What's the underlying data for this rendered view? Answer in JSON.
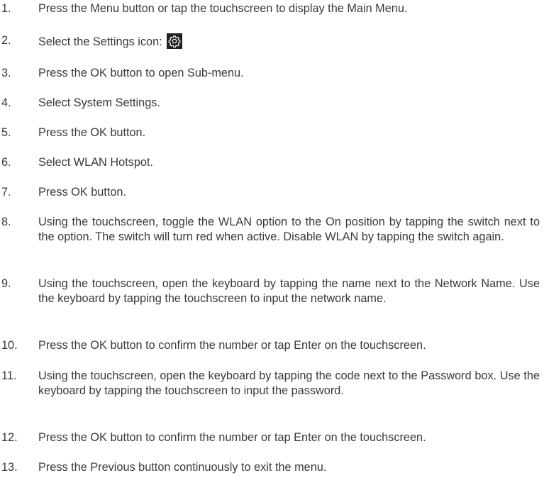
{
  "steps": [
    {
      "num": "1.",
      "text": "Press the Menu button or tap the touchscreen to display the Main Menu."
    },
    {
      "num": "2.",
      "text": "Select the Settings icon:",
      "icon": "settings-gear-icon"
    },
    {
      "num": "3.",
      "text": "Press the OK button to open Sub-menu."
    },
    {
      "num": "4.",
      "text": "Select System Settings."
    },
    {
      "num": "5.",
      "text": "Press the OK button."
    },
    {
      "num": "6.",
      "text": "Select WLAN Hotspot."
    },
    {
      "num": "7.",
      "text": "Press OK button."
    },
    {
      "num": "8.",
      "text": "Using the touchscreen, toggle the WLAN option to the On position by tapping the switch next to the option. The switch will turn red when active. Disable WLAN by tapping the switch again."
    },
    {
      "num": "9.",
      "text": "Using the touchscreen, open the keyboard by tapping the name next to the Network Name. Use the keyboard by tapping the touchscreen to input the network name."
    },
    {
      "num": "10.",
      "text": "Press the OK button to confirm the number or tap Enter on the touchscreen."
    },
    {
      "num": "11.",
      "text": "Using the touchscreen, open the keyboard by tapping the code next to the Password box. Use the keyboard by tapping the touchscreen to input the password."
    },
    {
      "num": "12.",
      "text": "Press the OK button to confirm the number or tap Enter on the touchscreen."
    },
    {
      "num": "13.",
      "text": "Press the Previous button continuously to exit the menu."
    }
  ]
}
